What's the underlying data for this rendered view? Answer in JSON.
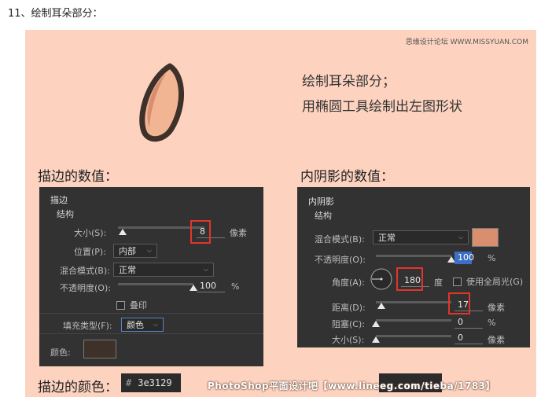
{
  "step_title": "11、绘制耳朵部分：",
  "watermark_top": "思缘设计论坛 WWW.MISSYUAN.COM",
  "intro": {
    "line1": "绘制耳朵部分；",
    "line2": "用椭圆工具绘制出左图形状"
  },
  "stroke_section": {
    "label": "描边的数值：",
    "panel_title": "描边",
    "group_title": "结构",
    "size_label": "大小(S):",
    "size_value": "8",
    "size_unit": "像素",
    "size_level_pct": 5,
    "position_label": "位置(P):",
    "position_value": "内部",
    "blend_label": "混合模式(B):",
    "blend_value": "正常",
    "opacity_label": "不透明度(O):",
    "opacity_value": "100",
    "opacity_unit": "%",
    "emboss_label": "叠印",
    "fill_type_label": "填充类型(F):",
    "fill_type_value": "颜色",
    "color_label": "颜色:",
    "color_hex": "#3e3129"
  },
  "inner_shadow_section": {
    "label": "内阴影的数值：",
    "panel_title": "内阴影",
    "group_title": "结构",
    "blend_label": "混合模式(B):",
    "blend_value": "正常",
    "swatch_color": "#d98e6e",
    "opacity_label": "不透明度(O):",
    "opacity_value": "100",
    "opacity_unit": "%",
    "angle_label": "角度(A):",
    "angle_value": "180",
    "angle_unit": "度",
    "global_light_label": "使用全局光(G)",
    "distance_label": "距离(D):",
    "distance_value": "17",
    "distance_unit": "像素",
    "choke_label": "阻塞(C):",
    "choke_value": "0",
    "choke_unit": "%",
    "size_label": "大小(S):",
    "size_value": "0",
    "size_unit": "像素"
  },
  "stroke_color": {
    "label": "描边的颜色：",
    "hash": "#",
    "value": "3e3129"
  },
  "watermark_bottom": "PhotoShop平面设计吧【www.lineeg.com/tieba/1783】",
  "colors": {
    "background": "#fdd3c0",
    "panel": "#323232",
    "highlight": "#e4342a",
    "ear_outline": "#3e3129",
    "ear_fill": "#f2b594",
    "ear_shadow": "#d98e6e"
  }
}
